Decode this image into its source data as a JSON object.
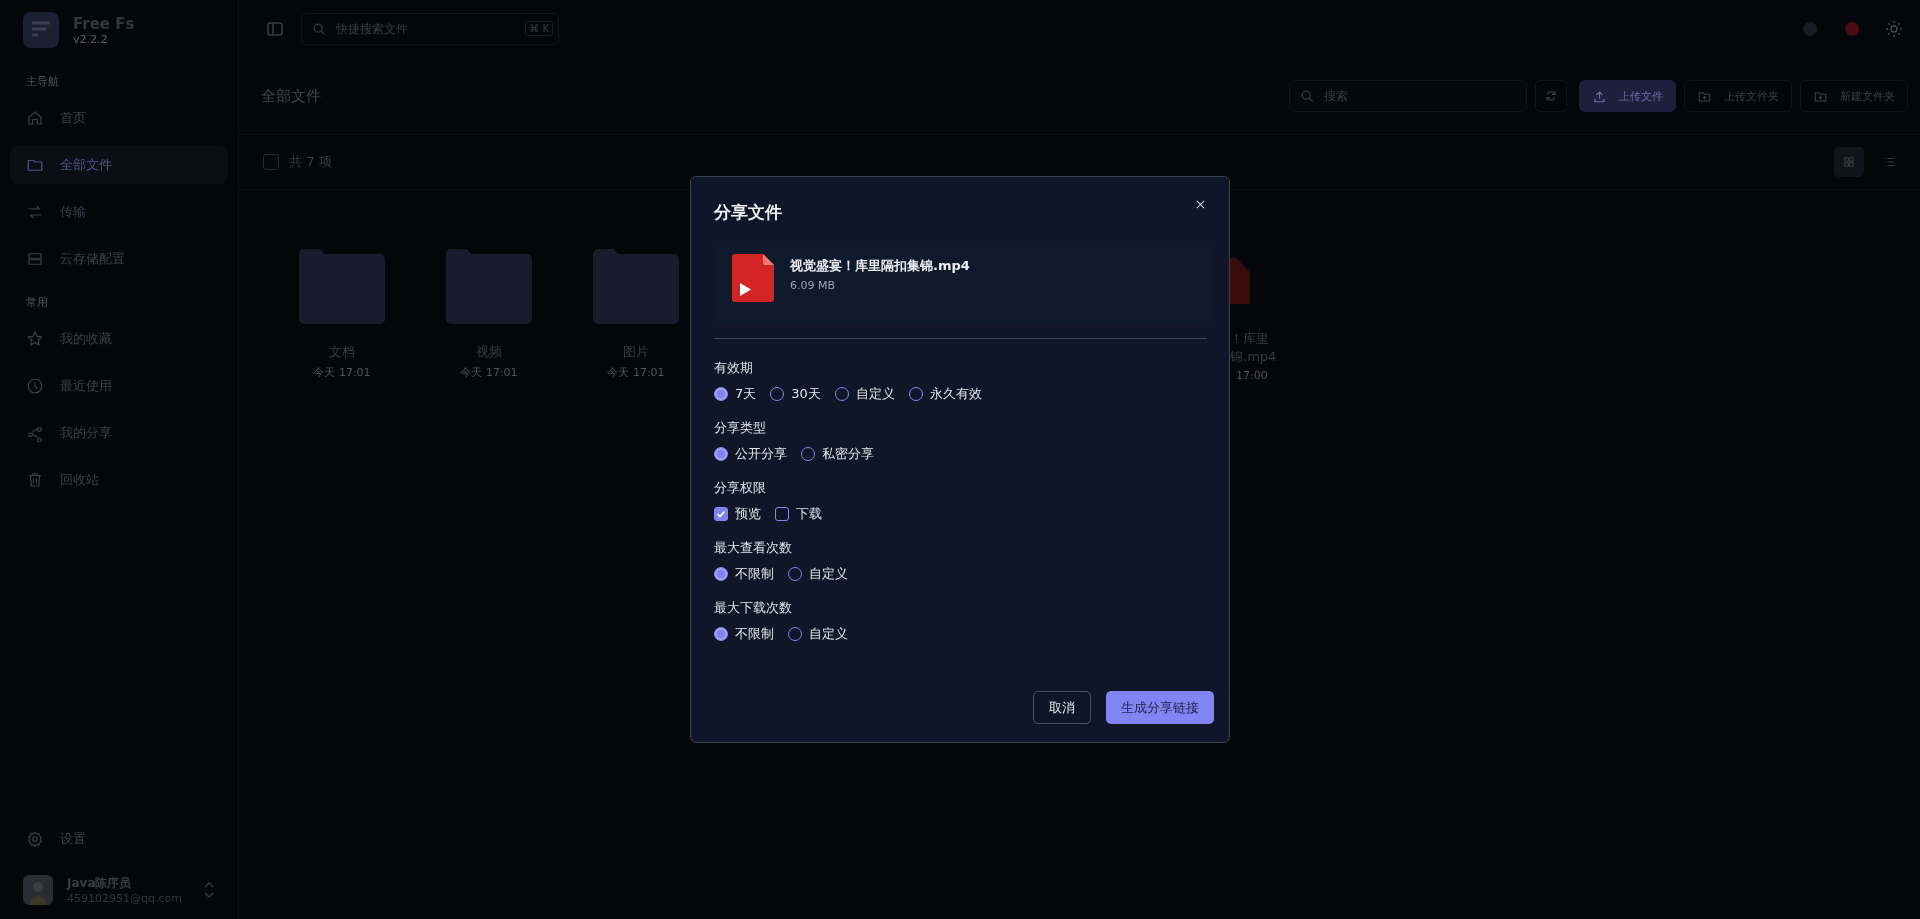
{
  "app": {
    "name": "Free Fs",
    "version": "v2.2.2"
  },
  "sidebar": {
    "sections": [
      {
        "title": "主导航",
        "items": [
          {
            "label": "首页",
            "selected": false
          },
          {
            "label": "全部文件",
            "selected": true
          },
          {
            "label": "传输",
            "selected": false
          },
          {
            "label": "云存储配置",
            "selected": false
          }
        ]
      },
      {
        "title": "常用",
        "items": [
          {
            "label": "我的收藏",
            "selected": false
          },
          {
            "label": "最近使用",
            "selected": false
          },
          {
            "label": "我的分享",
            "selected": false
          },
          {
            "label": "回收站",
            "selected": false
          }
        ]
      }
    ],
    "settings": "设置",
    "user": {
      "name": "Java陈序员",
      "email": "459102951@qq.com"
    }
  },
  "topbar": {
    "search_placeholder": "快捷搜索文件",
    "shortcut_symbol": "⌘",
    "shortcut": "K"
  },
  "header": {
    "title": "全部文件",
    "search_placeholder": "搜索",
    "buttons": [
      {
        "label": "上传文件",
        "primary": true
      },
      {
        "label": "上传文件夹",
        "primary": false
      },
      {
        "label": "新建文件夹",
        "primary": false
      }
    ]
  },
  "list": {
    "select_all_checked": false,
    "count": "共 7 项",
    "views": [
      {
        "kind": "grid",
        "selected": true
      },
      {
        "kind": "list",
        "selected": false
      }
    ]
  },
  "files": [
    {
      "kind": "folder",
      "name": "文档",
      "time": "今天 17:01"
    },
    {
      "kind": "folder",
      "name": "视频",
      "time": "今天 17:01"
    },
    {
      "kind": "folder",
      "name": "图片",
      "time": "今天 17:01"
    }
  ],
  "hidden_file": {
    "name_lines": [
      "！库里",
      "锦.mp4"
    ],
    "time": "17:00"
  },
  "dialog": {
    "title": "分享文件",
    "file": {
      "name": "视觉盛宴！库里隔扣集锦.mp4",
      "size": "6.09 MB"
    },
    "groups": [
      {
        "label": "有效期",
        "kind": "radio",
        "options": [
          {
            "label": "7天",
            "selected": true
          },
          {
            "label": "30天",
            "selected": false
          },
          {
            "label": "自定义",
            "selected": false
          },
          {
            "label": "永久有效",
            "selected": false
          }
        ]
      },
      {
        "label": "分享类型",
        "kind": "radio",
        "options": [
          {
            "label": "公开分享",
            "selected": true
          },
          {
            "label": "私密分享",
            "selected": false
          }
        ]
      },
      {
        "label": "分享权限",
        "kind": "checkbox",
        "options": [
          {
            "label": "预览",
            "checked": true
          },
          {
            "label": "下载",
            "checked": false
          }
        ]
      },
      {
        "label": "最大查看次数",
        "kind": "radio",
        "options": [
          {
            "label": "不限制",
            "selected": true
          },
          {
            "label": "自定义",
            "selected": false
          }
        ]
      },
      {
        "label": "最大下载次数",
        "kind": "radio",
        "options": [
          {
            "label": "不限制",
            "selected": true
          },
          {
            "label": "自定义",
            "selected": false
          }
        ]
      }
    ],
    "cancel": "取消",
    "confirm": "生成分享链接"
  }
}
